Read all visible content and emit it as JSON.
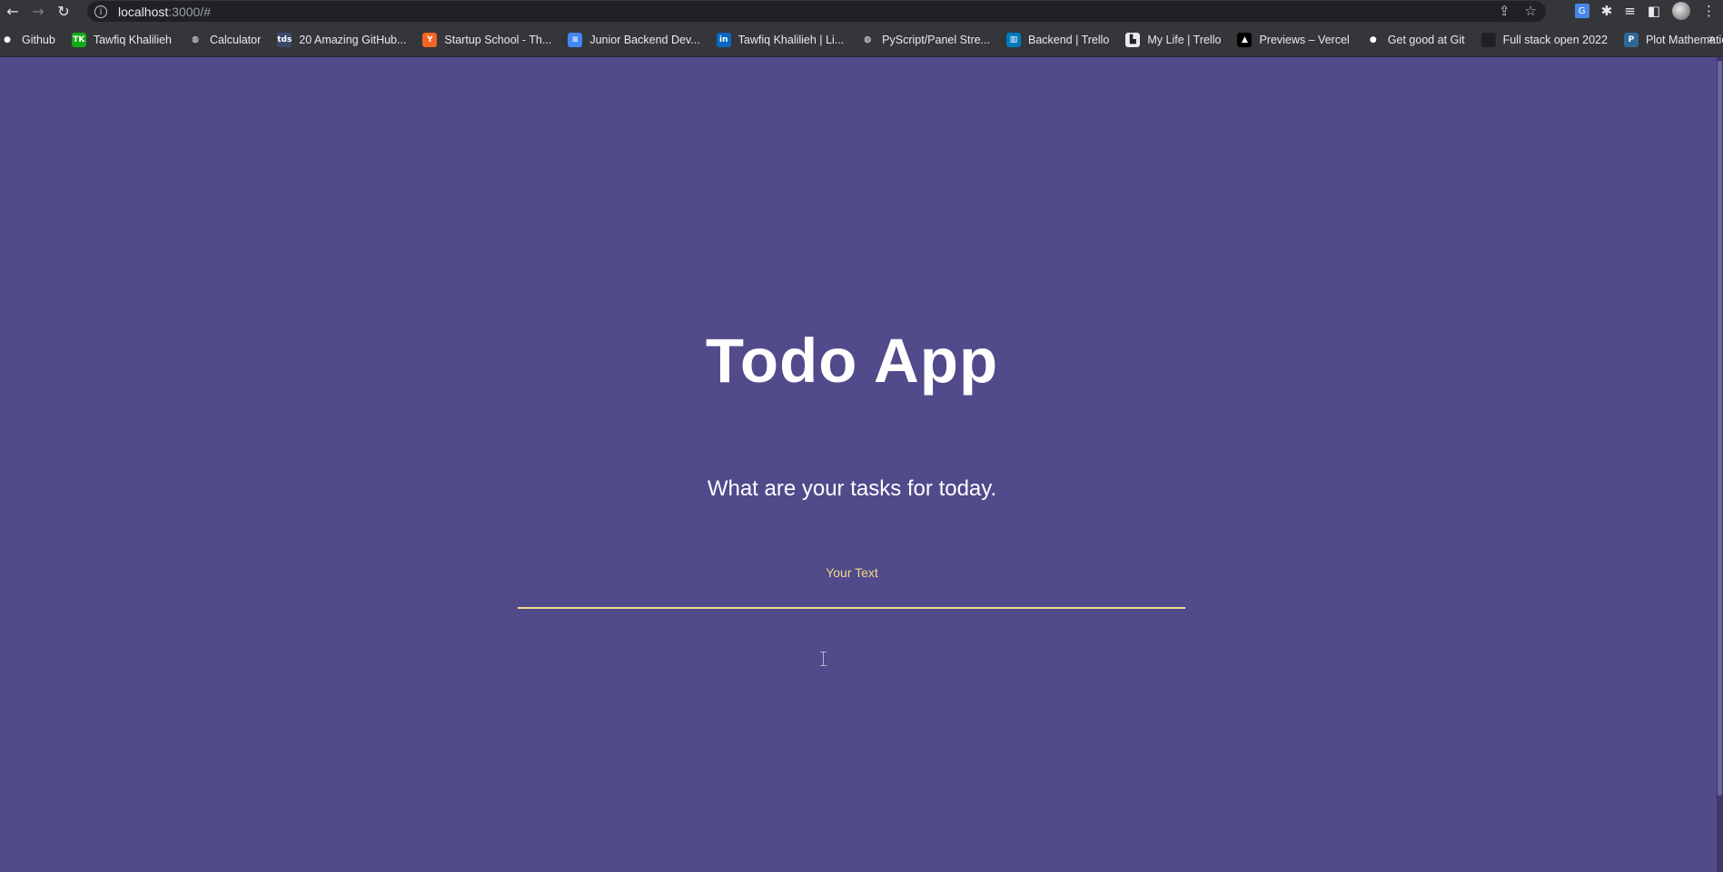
{
  "browser": {
    "url_host": "localhost",
    "url_path": ":3000/#"
  },
  "bookmarks": [
    {
      "label": "Github",
      "icon": "github-icon",
      "color": "#35363a",
      "glyph": "●"
    },
    {
      "label": "Tawfiq Khalilieh",
      "icon": "tk-favicon",
      "color": "#16a916",
      "glyph": "TK"
    },
    {
      "label": "Calculator",
      "icon": "globe-icon",
      "color": "#35363a",
      "glyph": "◍"
    },
    {
      "label": "20 Amazing GitHub...",
      "icon": "dev-favicon",
      "color": "#3b4a6b",
      "glyph": "tds"
    },
    {
      "label": "Startup School - Th...",
      "icon": "ycombinator-icon",
      "color": "#f26522",
      "glyph": "Y"
    },
    {
      "label": "Junior Backend Dev...",
      "icon": "docs-icon",
      "color": "#4285f4",
      "glyph": "≡"
    },
    {
      "label": "Tawfiq Khalilieh | Li...",
      "icon": "linkedin-icon",
      "color": "#0a66c2",
      "glyph": "in"
    },
    {
      "label": "PyScript/Panel Stre...",
      "icon": "globe-icon",
      "color": "#35363a",
      "glyph": "◍"
    },
    {
      "label": "Backend | Trello",
      "icon": "trello-icon",
      "color": "#0079bf",
      "glyph": "▥"
    },
    {
      "label": "My Life | Trello",
      "icon": "notion-icon",
      "color": "#e8eaed",
      "glyph": "▙"
    },
    {
      "label": "Previews – Vercel",
      "icon": "vercel-icon",
      "color": "#000000",
      "glyph": "▲"
    },
    {
      "label": "Get good at Git",
      "icon": "git-icon",
      "color": "#35363a",
      "glyph": "●"
    },
    {
      "label": "Full stack open 2022",
      "icon": "fso-icon",
      "color": "#202124",
      "glyph": " "
    },
    {
      "label": "Plot Mathematical F...",
      "icon": "python-icon",
      "color": "#306998",
      "glyph": "P"
    }
  ],
  "app": {
    "title": "Todo App",
    "subtitle": "What are your tasks for today.",
    "input_label": "Your Text",
    "input_value": ""
  },
  "colors": {
    "background": "#514a8b",
    "accent": "#f5d98a"
  }
}
